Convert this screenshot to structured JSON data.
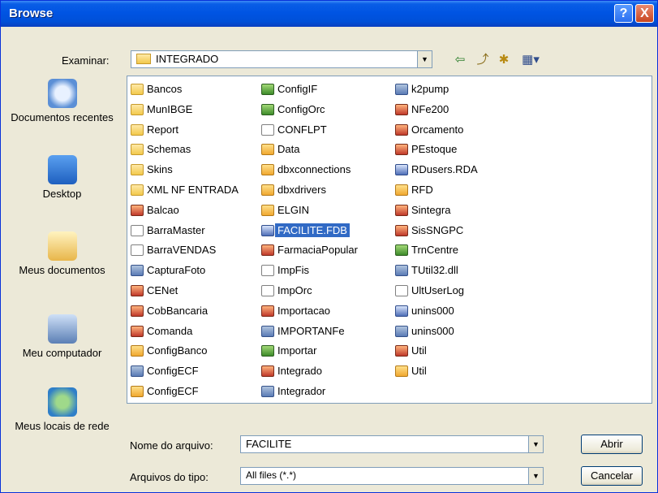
{
  "window": {
    "title": "Browse"
  },
  "lookin": {
    "label": "Examinar:",
    "value": "INTEGRADO"
  },
  "places": [
    {
      "name": "recent",
      "label": "Documentos recentes",
      "icon": "recent-documents-icon"
    },
    {
      "name": "desktop",
      "label": "Desktop",
      "icon": "desktop-icon"
    },
    {
      "name": "mydocs",
      "label": "Meus documentos",
      "icon": "my-documents-icon"
    },
    {
      "name": "mycomputer",
      "label": "Meu computador",
      "icon": "my-computer-icon"
    },
    {
      "name": "network",
      "label": "Meus locais de rede",
      "icon": "network-places-icon"
    }
  ],
  "files": {
    "col1": [
      {
        "name": "Bancos",
        "type": "folder"
      },
      {
        "name": "MunIBGE",
        "type": "folder"
      },
      {
        "name": "Report",
        "type": "folder"
      },
      {
        "name": "Schemas",
        "type": "folder"
      },
      {
        "name": "Skins",
        "type": "folder"
      },
      {
        "name": "XML NF ENTRADA",
        "type": "folder"
      },
      {
        "name": "Balcao",
        "type": "fb"
      },
      {
        "name": "BarraMaster",
        "type": "doc"
      },
      {
        "name": "BarraVENDAS",
        "type": "doc"
      },
      {
        "name": "CapturaFoto",
        "type": "app"
      },
      {
        "name": "CENet",
        "type": "fb"
      },
      {
        "name": "CobBancaria",
        "type": "fb"
      },
      {
        "name": "Comanda",
        "type": "fb"
      },
      {
        "name": "ConfigBanco",
        "type": "lnk"
      },
      {
        "name": "ConfigECF",
        "type": "app"
      },
      {
        "name": "ConfigECF",
        "type": "lnk"
      }
    ],
    "col2": [
      {
        "name": "ConfigIF",
        "type": "cfg"
      },
      {
        "name": "ConfigOrc",
        "type": "cfg"
      },
      {
        "name": "CONFLPT",
        "type": "doc"
      },
      {
        "name": "Data",
        "type": "lnk"
      },
      {
        "name": "dbxconnections",
        "type": "lnk"
      },
      {
        "name": "dbxdrivers",
        "type": "lnk"
      },
      {
        "name": "ELGIN",
        "type": "lnk"
      },
      {
        "name": "FACILITE.FDB",
        "type": "db",
        "selected": true
      },
      {
        "name": "FarmaciaPopular",
        "type": "fb"
      },
      {
        "name": "ImpFis",
        "type": "doc"
      },
      {
        "name": "ImpOrc",
        "type": "doc"
      },
      {
        "name": "Importacao",
        "type": "fb"
      },
      {
        "name": "IMPORTANFe",
        "type": "app"
      },
      {
        "name": "Importar",
        "type": "cfg"
      },
      {
        "name": "Integrado",
        "type": "fb"
      },
      {
        "name": "Integrador",
        "type": "app"
      }
    ],
    "col3": [
      {
        "name": "k2pump",
        "type": "app"
      },
      {
        "name": "NFe200",
        "type": "fb"
      },
      {
        "name": "Orcamento",
        "type": "fb"
      },
      {
        "name": "PEstoque",
        "type": "fb"
      },
      {
        "name": "RDusers.RDA",
        "type": "db"
      },
      {
        "name": "RFD",
        "type": "lnk"
      },
      {
        "name": "Sintegra",
        "type": "fb"
      },
      {
        "name": "SisSNGPC",
        "type": "fb"
      },
      {
        "name": "TrnCentre",
        "type": "cfg"
      },
      {
        "name": "TUtil32.dll",
        "type": "app"
      },
      {
        "name": "UltUserLog",
        "type": "doc"
      },
      {
        "name": "unins000",
        "type": "db"
      },
      {
        "name": "unins000",
        "type": "app"
      },
      {
        "name": "Util",
        "type": "fb"
      },
      {
        "name": "Util",
        "type": "lnk"
      }
    ]
  },
  "filename": {
    "label": "Nome do arquivo:",
    "value": "FACILITE"
  },
  "filetype": {
    "label": "Arquivos do tipo:",
    "value": "All files (*.*)"
  },
  "buttons": {
    "open": "Abrir",
    "cancel": "Cancelar",
    "help": "?",
    "close": "X"
  }
}
